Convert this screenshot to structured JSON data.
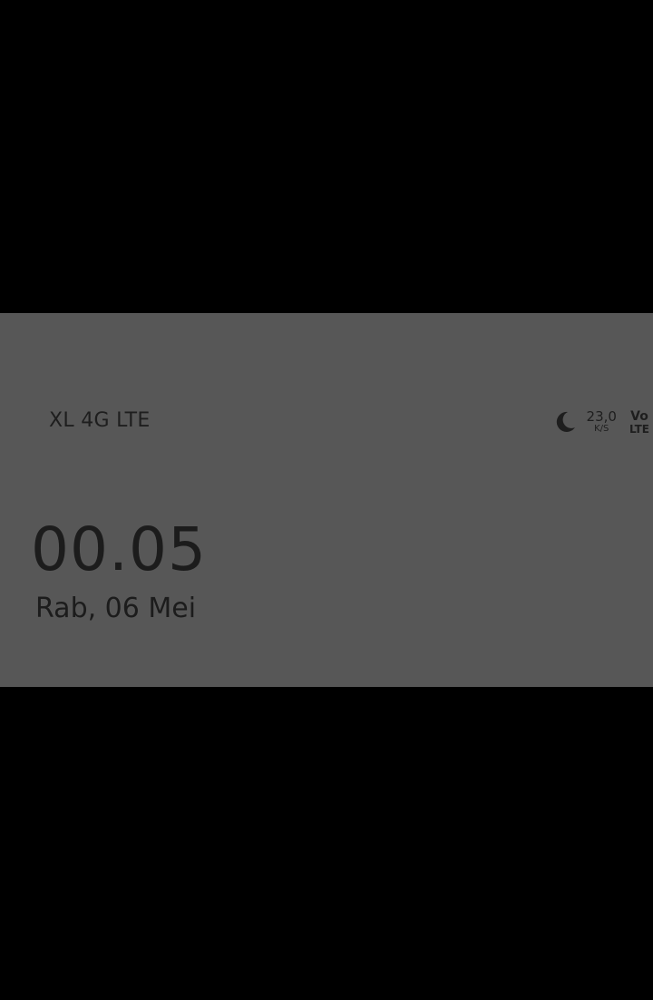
{
  "status_bar": {
    "carrier": "XL 4G LTE",
    "network_speed_value": "23,0",
    "network_speed_unit": "K/S",
    "volte_top": "Vo",
    "volte_bottom": "LTE",
    "dnd_icon": "moon-icon"
  },
  "notification_header": {
    "time": "00.05",
    "date": "Rab, 06 Mei"
  },
  "colors": {
    "background": "#000000",
    "panel": "#575757",
    "text": "#1c1c1c"
  }
}
